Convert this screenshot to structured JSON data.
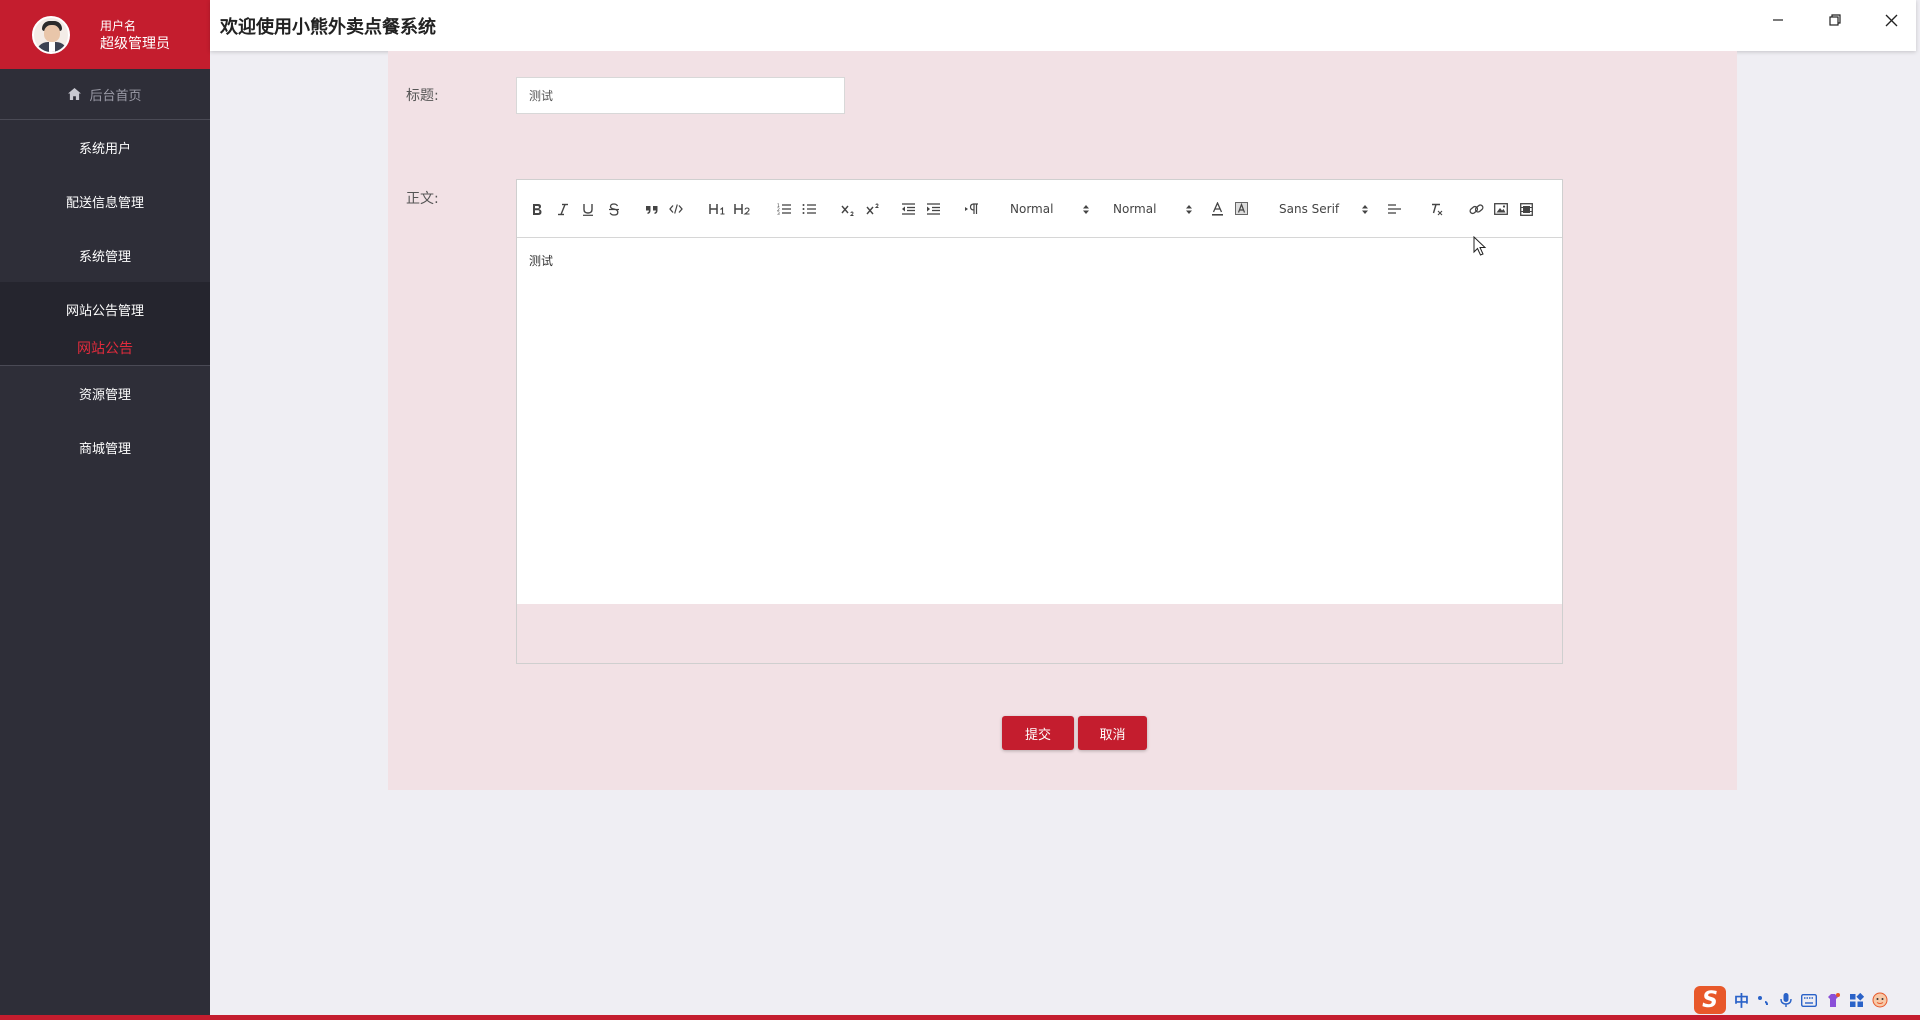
{
  "user": {
    "name": "用户名",
    "role": "超级管理员"
  },
  "app": {
    "title": "欢迎使用小熊外卖点餐系统"
  },
  "sidebar": {
    "home": "后台首页",
    "items": [
      {
        "label": "系统用户"
      },
      {
        "label": "配送信息管理"
      },
      {
        "label": "系统管理"
      },
      {
        "label": "网站公告管理",
        "expanded": true,
        "children": [
          {
            "label": "网站公告",
            "active": true
          }
        ]
      },
      {
        "label": "资源管理"
      },
      {
        "label": "商城管理"
      }
    ]
  },
  "form": {
    "title_label": "标题:",
    "title_value": "测试",
    "body_label": "正文:",
    "body_text": "测试",
    "editor": {
      "header_picker": "Normal",
      "size_picker": "Normal",
      "font_picker": "Sans Serif"
    },
    "submit_label": "提交",
    "cancel_label": "取消"
  },
  "tray": {
    "ime_mode": "中"
  },
  "colors": {
    "accent": "#c41d2e",
    "sidebar_bg": "#2e2e38",
    "panel_bg": "#f2e1e5",
    "active_text": "#e02b3c"
  }
}
